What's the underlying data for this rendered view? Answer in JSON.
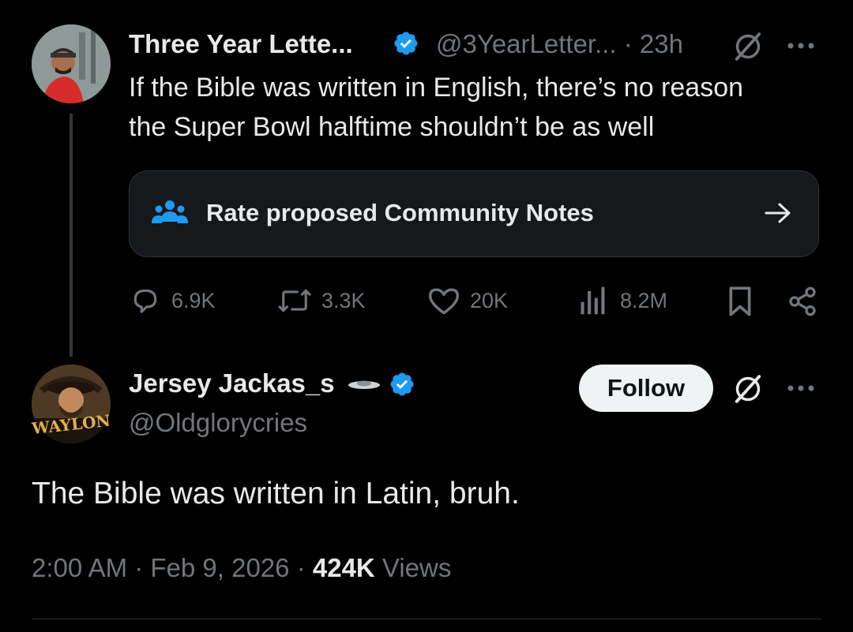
{
  "parent_tweet": {
    "display_name": "Three Year Lette...",
    "handle_time": "@3YearLetter... · 23h",
    "text_line1": "If the Bible was written in English, there’s no reason",
    "text_line2": "the Super Bowl halftime shouldn’t be as well",
    "community_notes_label": "Rate proposed Community Notes",
    "actions": {
      "replies": "6.9K",
      "reposts": "3.3K",
      "likes": "20K",
      "views": "8.2M"
    }
  },
  "reply_tweet": {
    "display_name": "Jersey Jackas_s",
    "handle": "@Oldglorycries",
    "follow_label": "Follow",
    "text": "The Bible was written in Latin, bruh.",
    "timestamp": "2:00 AM · Feb 9, 2026 · ",
    "views_count": "424K",
    "views_label": " Views",
    "avatar_banner_text": "WAYLON"
  },
  "colors": {
    "background": "#000000",
    "verified_blue": "#1d9bf0",
    "muted_text": "#71767b",
    "primary_text": "#e7e9ea"
  },
  "icons": [
    "grok-icon",
    "more-icon",
    "community-notes-icon",
    "arrow-right-icon",
    "reply-icon",
    "repost-icon",
    "like-icon",
    "views-icon",
    "bookmark-icon",
    "share-icon",
    "verified-badge-icon"
  ]
}
